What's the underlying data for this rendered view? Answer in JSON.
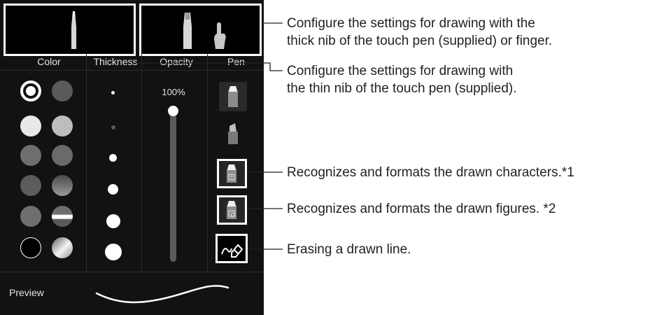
{
  "columns": {
    "color": "Color",
    "thickness": "Thickness",
    "opacity": "Opacity",
    "pen": "Pen"
  },
  "opacity": {
    "value_label": "100%",
    "level": 1.0
  },
  "preview": {
    "label": "Preview"
  },
  "swatches": [
    {
      "row": 0,
      "col": 0,
      "fill": "#ffffff",
      "selected": true
    },
    {
      "row": 0,
      "col": 1,
      "fill": "#5a5a5a"
    },
    {
      "row": 1,
      "col": 0,
      "fill": "#e8e8e8"
    },
    {
      "row": 1,
      "col": 1,
      "fill": "#bdbdbd"
    },
    {
      "row": 2,
      "col": 0,
      "fill": "#6e6e6e"
    },
    {
      "row": 2,
      "col": 1,
      "fill": "#6a6a6a"
    },
    {
      "row": 3,
      "col": 0,
      "fill": "#5c5c5c"
    },
    {
      "row": 3,
      "col": 1,
      "fill": "gradient-gray"
    },
    {
      "row": 4,
      "col": 0,
      "fill": "#6f6f6f"
    },
    {
      "row": 4,
      "col": 1,
      "fill": "gradient-stripe"
    },
    {
      "row": 5,
      "col": 0,
      "fill": "#000000"
    },
    {
      "row": 5,
      "col": 1,
      "fill": "gradient-metal"
    }
  ],
  "callouts": {
    "thick": {
      "line1": "Configure the settings for drawing with the",
      "line2": "thick nib of the touch pen (supplied) or finger."
    },
    "thin": {
      "line1": "Configure the settings for drawing with",
      "line2": "the thin nib of the touch pen (supplied)."
    },
    "characters": "Recognizes and formats the drawn characters.*1",
    "figures": "Recognizes and formats the drawn figures. *2",
    "erase": "Erasing a drawn line."
  }
}
